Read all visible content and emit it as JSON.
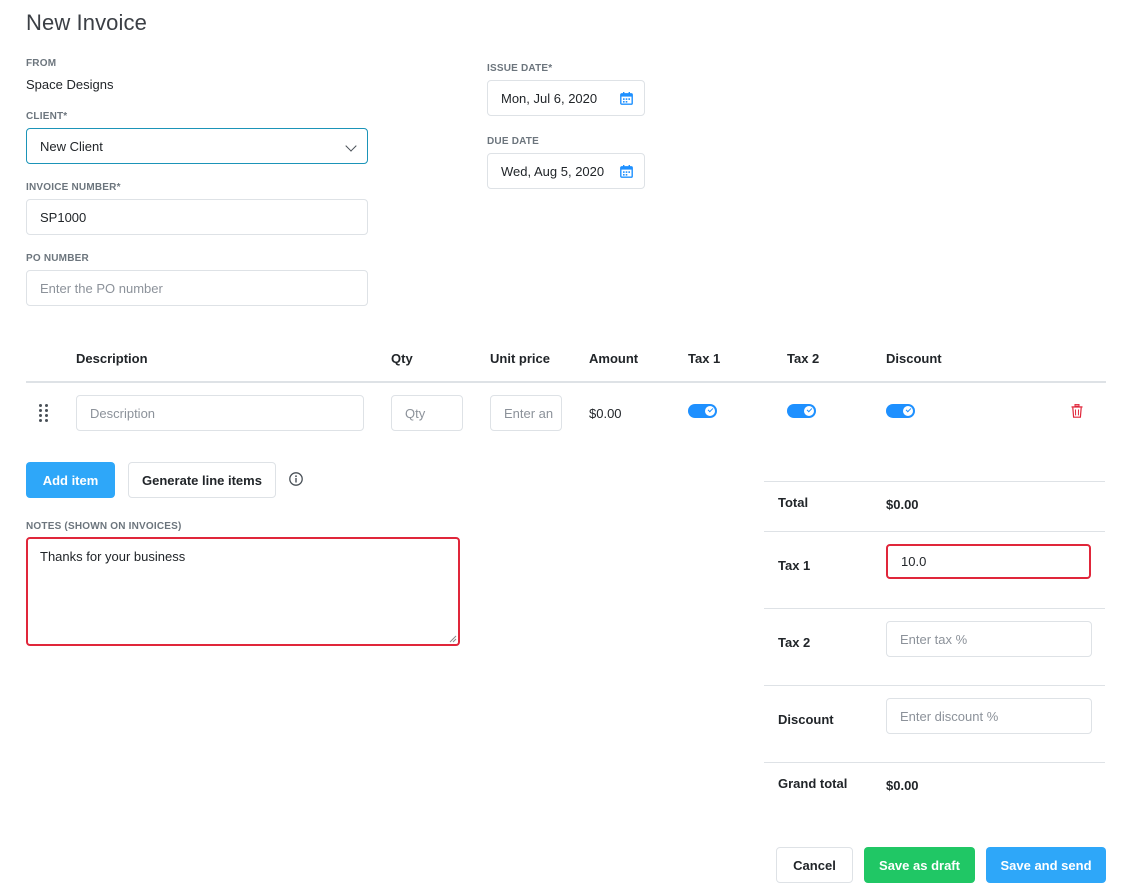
{
  "page": {
    "title": "New Invoice"
  },
  "from": {
    "label": "FROM",
    "value": "Space Designs"
  },
  "client": {
    "label": "CLIENT*",
    "value": "New Client"
  },
  "invoice_number": {
    "label": "INVOICE NUMBER*",
    "value": "SP1000"
  },
  "po_number": {
    "label": "PO NUMBER",
    "placeholder": "Enter the PO number"
  },
  "issue_date": {
    "label": "ISSUE DATE*",
    "value": "Mon, Jul 6, 2020"
  },
  "due_date": {
    "label": "DUE DATE",
    "value": "Wed, Aug 5, 2020"
  },
  "table": {
    "headers": [
      "Description",
      "Qty",
      "Unit price",
      "Amount",
      "Tax 1",
      "Tax 2",
      "Discount"
    ],
    "row": {
      "description_placeholder": "Description",
      "qty_placeholder": "Qty",
      "unit_price_placeholder": "Enter an",
      "amount": "$0.00",
      "tax1_on": true,
      "tax2_on": true,
      "discount_on": true
    }
  },
  "actions": {
    "add_item": "Add item",
    "generate_line_items": "Generate line items"
  },
  "notes": {
    "label": "NOTES (SHOWN ON INVOICES)",
    "value": "Thanks for your business"
  },
  "summary": {
    "total_label": "Total",
    "total_value": "$0.00",
    "tax1_label": "Tax 1",
    "tax1_value": "10.0",
    "tax2_label": "Tax 2",
    "tax2_placeholder": "Enter tax %",
    "discount_label": "Discount",
    "discount_placeholder": "Enter discount %",
    "grand_total_label": "Grand total",
    "grand_total_value": "$0.00"
  },
  "footer": {
    "cancel": "Cancel",
    "save_draft": "Save as draft",
    "save_send": "Save and send"
  },
  "colors": {
    "primary": "#2ea7f9",
    "success": "#20c765",
    "danger": "#e0263a",
    "focus": "#1b94b8"
  }
}
